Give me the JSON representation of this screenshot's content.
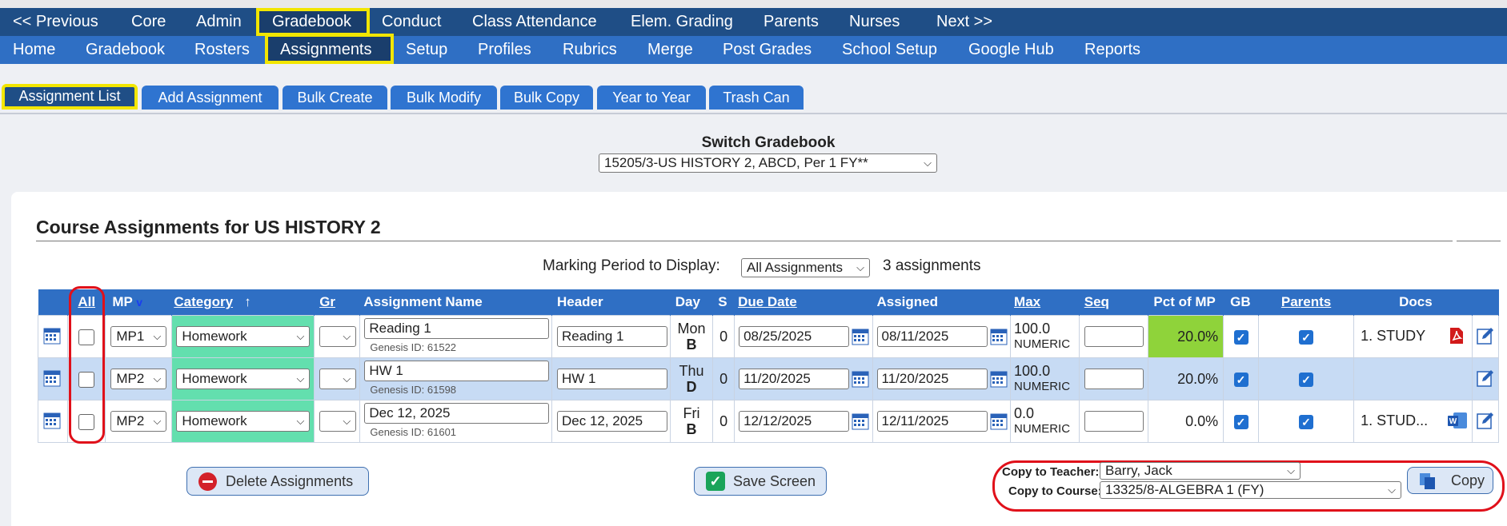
{
  "nav_primary": [
    "<< Previous",
    "Core",
    "Admin",
    "Gradebook",
    "Conduct",
    "Class Attendance",
    "Elem. Grading",
    "Parents",
    "Nurses",
    "Next >>"
  ],
  "nav_secondary": [
    "Home",
    "Gradebook",
    "Rosters",
    "Assignments",
    "Setup",
    "Profiles",
    "Rubrics",
    "Merge",
    "Post Grades",
    "School Setup",
    "Google Hub",
    "Reports"
  ],
  "tabs": [
    "Assignment List",
    "Add Assignment",
    "Bulk Create",
    "Bulk Modify",
    "Bulk Copy",
    "Year to Year",
    "Trash Can"
  ],
  "switch_gradebook": {
    "title": "Switch Gradebook",
    "selected": "15205/3-US HISTORY 2, ABCD, Per 1 FY**"
  },
  "panel": {
    "title": "Course Assignments for US HISTORY 2",
    "marking_period_label": "Marking Period to Display:",
    "marking_period_value": "All Assignments",
    "count": "3 assignments"
  },
  "columns": {
    "all": "All",
    "mp": "MP",
    "mp_arrow": "v",
    "category": "Category",
    "category_arrow": "↑",
    "gr": "Gr",
    "name": "Assignment Name",
    "header": "Header",
    "day": "Day",
    "s": "S",
    "due": "Due Date",
    "assigned": "Assigned",
    "max": "Max",
    "seq": "Seq",
    "pct": "Pct of MP",
    "gb": "GB",
    "parents": "Parents",
    "docs": "Docs"
  },
  "rows": [
    {
      "mp": "MP1",
      "category": "Homework",
      "name": "Reading 1",
      "genesis": "Genesis ID: 61522",
      "header": "Reading 1",
      "day": "Mon",
      "day_letter": "B",
      "s": "0",
      "due": "08/25/2025",
      "assigned": "08/11/2025",
      "max": "100.0",
      "max_type": "NUMERIC",
      "pct": "20.0%",
      "doc": "1.  STUDY",
      "doc_icon": "pdf-icon"
    },
    {
      "mp": "MP2",
      "category": "Homework",
      "name": "HW 1",
      "genesis": "Genesis ID: 61598",
      "header": "HW 1",
      "day": "Thu",
      "day_letter": "D",
      "s": "0",
      "due": "11/20/2025",
      "assigned": "11/20/2025",
      "max": "100.0",
      "max_type": "NUMERIC",
      "pct": "20.0%",
      "doc": "",
      "doc_icon": ""
    },
    {
      "mp": "MP2",
      "category": "Homework",
      "name": "Dec 12, 2025",
      "genesis": "Genesis ID: 61601",
      "header": "Dec 12, 2025",
      "day": "Fri",
      "day_letter": "B",
      "s": "0",
      "due": "12/12/2025",
      "assigned": "12/11/2025",
      "max": "0.0",
      "max_type": "NUMERIC",
      "pct": "0.0%",
      "doc": "1.  STUD...",
      "doc_icon": "word-icon"
    }
  ],
  "buttons": {
    "delete": "Delete Assignments",
    "save": "Save Screen",
    "copy": "Copy"
  },
  "copy": {
    "teacher_label": "Copy to Teacher:",
    "teacher_value": "Barry, Jack",
    "course_label": "Copy to Course:",
    "course_value": "13325/8-ALGEBRA 1 (FY)"
  },
  "colors": {
    "nav_dark": "#1f4e86",
    "nav_light": "#2f6fc4",
    "highlight": "#f2e600",
    "category": "#63dfae",
    "pct_green": "#8fd33a",
    "annotation": "#e0101a"
  }
}
